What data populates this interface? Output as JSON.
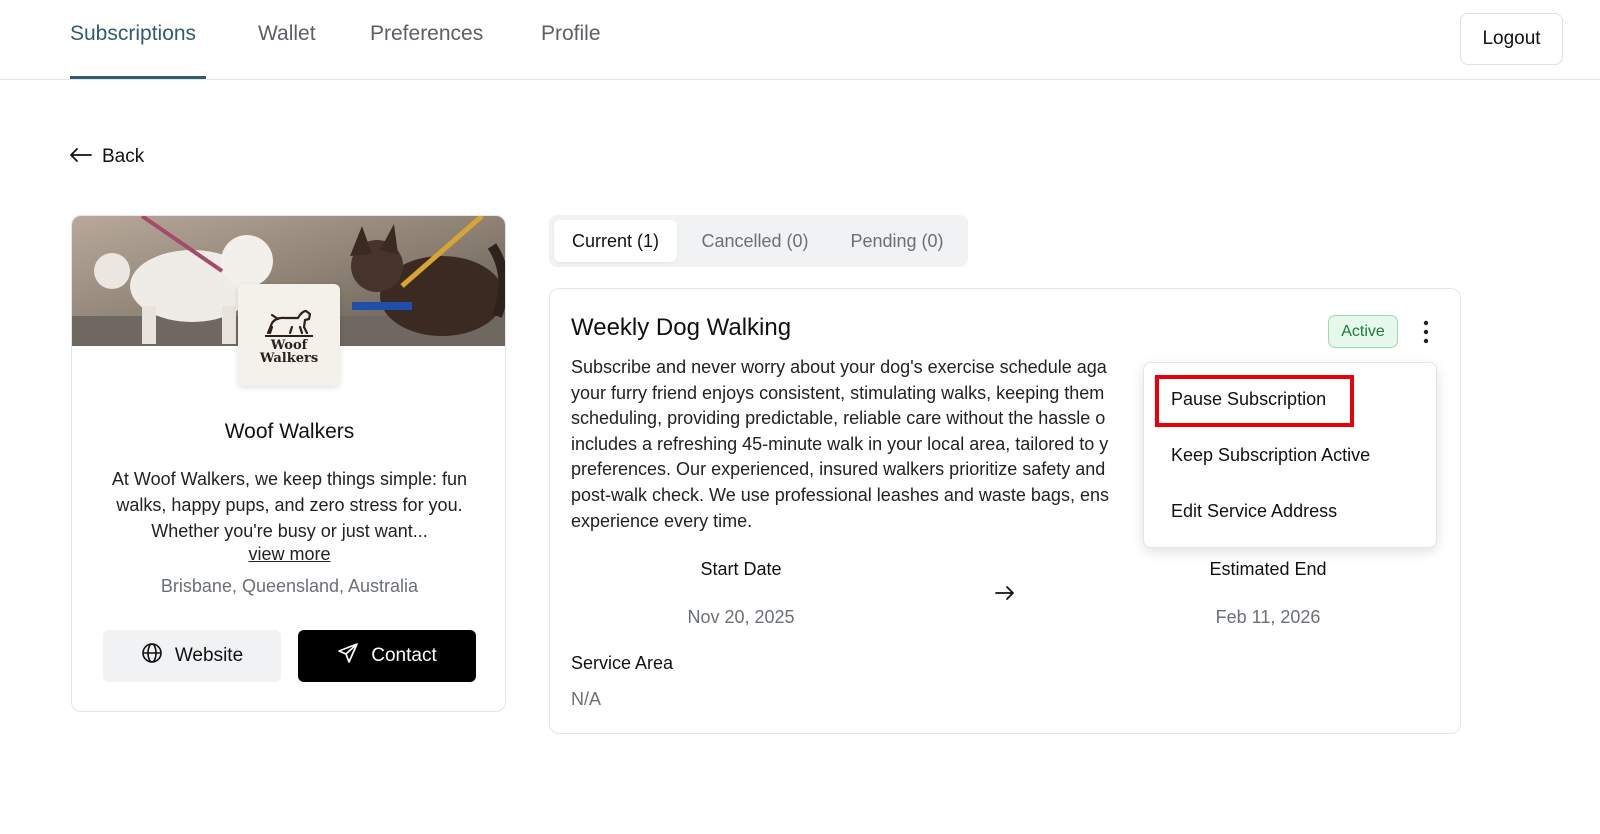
{
  "nav": {
    "tabs": [
      {
        "label": "Subscriptions",
        "active": true
      },
      {
        "label": "Wallet",
        "active": false
      },
      {
        "label": "Preferences",
        "active": false
      },
      {
        "label": "Profile",
        "active": false
      }
    ],
    "logout_label": "Logout"
  },
  "back_label": "Back",
  "provider": {
    "logo_text_line1": "Woof",
    "logo_text_line2": "Walkers",
    "name": "Woof Walkers",
    "description": "At Woof Walkers, we keep things simple: fun walks, happy pups, and zero stress for you. Whether you're busy or just want...",
    "view_more_label": "view more",
    "location": "Brisbane, Queensland, Australia",
    "website_label": "Website",
    "contact_label": "Contact"
  },
  "subscription_tabs": [
    {
      "label": "Current (1)",
      "active": true
    },
    {
      "label": "Cancelled (0)",
      "active": false
    },
    {
      "label": "Pending (0)",
      "active": false
    }
  ],
  "subscription": {
    "title": "Weekly Dog Walking",
    "status": "Active",
    "description_lines": [
      "Subscribe and never worry about your dog's exercise schedule aga",
      "your furry friend enjoys consistent, stimulating walks, keeping them",
      "scheduling, providing predictable, reliable care without the hassle o",
      "includes a refreshing 45-minute walk in your local area, tailored to y",
      "preferences. Our experienced, insured walkers prioritize safety and",
      "post-walk check. We use professional leashes and waste bags, ens",
      "experience every time."
    ],
    "start_date_label": "Start Date",
    "start_date": "Nov 20, 2025",
    "end_date_label": "Estimated End",
    "end_date": "Feb 11, 2026",
    "service_area_label": "Service Area",
    "service_area": "N/A"
  },
  "menu": {
    "items": [
      {
        "label": "Pause Subscription"
      },
      {
        "label": "Keep Subscription Active"
      },
      {
        "label": "Edit Service Address"
      }
    ]
  },
  "colors": {
    "nav_active": "#2f5d6e",
    "badge_bg": "#e6f8ec",
    "badge_text": "#1e7a3e",
    "highlight": "#e8000b"
  }
}
